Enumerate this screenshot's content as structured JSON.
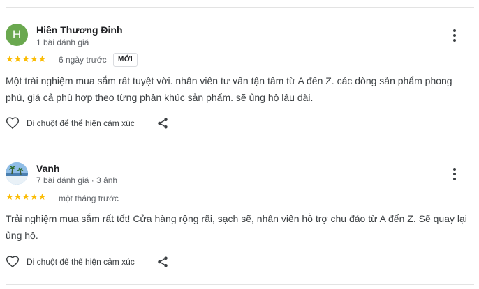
{
  "reviews": [
    {
      "avatar_letter": "H",
      "name": "Hiền Thương Đinh",
      "meta": "1 bài đánh giá",
      "stars": "★★★★★",
      "date": "6 ngày trước",
      "badge": "MỚI",
      "text": "Một trải nghiệm mua sắm rất tuyệt vời. nhân viên tư vấn tận tâm từ A đến Z. các dòng sản phẩm phong phú, giá cả phù hợp theo từng phân khúc sản phẩm. sẽ ủng hộ lâu dài.",
      "react_label": "Di chuột để thể hiện cảm xúc"
    },
    {
      "name": "Vanh",
      "meta": "7 bài đánh giá · 3 ảnh",
      "stars": "★★★★★",
      "date": "một tháng trước",
      "text": "Trải nghiệm mua sắm rất tốt! Cửa hàng rộng rãi, sạch sẽ, nhân viên hỗ trợ chu đáo từ A đến Z. Sẽ quay lại ủng hộ.",
      "react_label": "Di chuột để thể hiện cảm xúc"
    }
  ],
  "colors": {
    "star": "#fbbc04",
    "avatar_bg": "#6aa84f"
  },
  "icons": [
    "more-vert-icon",
    "heart-outline-icon",
    "share-icon"
  ]
}
